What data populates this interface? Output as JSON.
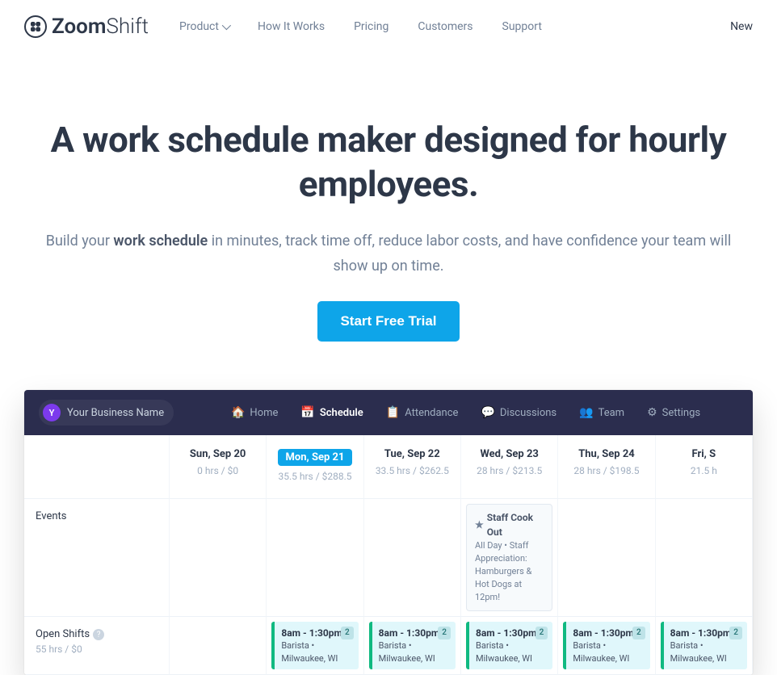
{
  "nav": {
    "brand_bold": "Zoom",
    "brand_light": "Shift",
    "links": [
      "Product",
      "How It Works",
      "Pricing",
      "Customers",
      "Support"
    ],
    "right": "New"
  },
  "hero": {
    "title": "A work schedule maker designed for hourly employees.",
    "sub_pre": "Build your ",
    "sub_strong": "work schedule",
    "sub_post": " in minutes, track time off, reduce labor costs, and have confidence your team will show up on time.",
    "cta": "Start Free Trial"
  },
  "app": {
    "biz_initial": "Y",
    "biz_name": "Your Business Name",
    "nav": {
      "home": "Home",
      "schedule": "Schedule",
      "attendance": "Attendance",
      "discussions": "Discussions",
      "team": "Team",
      "settings": "Settings"
    }
  },
  "schedule": {
    "days": [
      {
        "label": "Sun, Sep 20",
        "summary": "0 hrs / $0",
        "today": false
      },
      {
        "label": "Mon, Sep 21",
        "summary": "35.5 hrs / $288.5",
        "today": true
      },
      {
        "label": "Tue, Sep 22",
        "summary": "33.5 hrs / $262.5",
        "today": false
      },
      {
        "label": "Wed, Sep 23",
        "summary": "28 hrs / $213.5",
        "today": false
      },
      {
        "label": "Thu, Sep 24",
        "summary": "28 hrs / $198.5",
        "today": false
      },
      {
        "label": "Fri, S",
        "summary": "21.5 h",
        "today": false
      }
    ],
    "events_label": "Events",
    "event": {
      "title": "Staff Cook Out",
      "detail": "All Day • Staff Appreciation: Hamburgers & Hot Dogs at 12pm!"
    },
    "openshifts": {
      "label": "Open Shifts",
      "sub": "55 hrs / $0",
      "card": {
        "time": "8am - 1:30pm",
        "count": "2",
        "detail": "Barista • Milwaukee, WI"
      }
    }
  }
}
